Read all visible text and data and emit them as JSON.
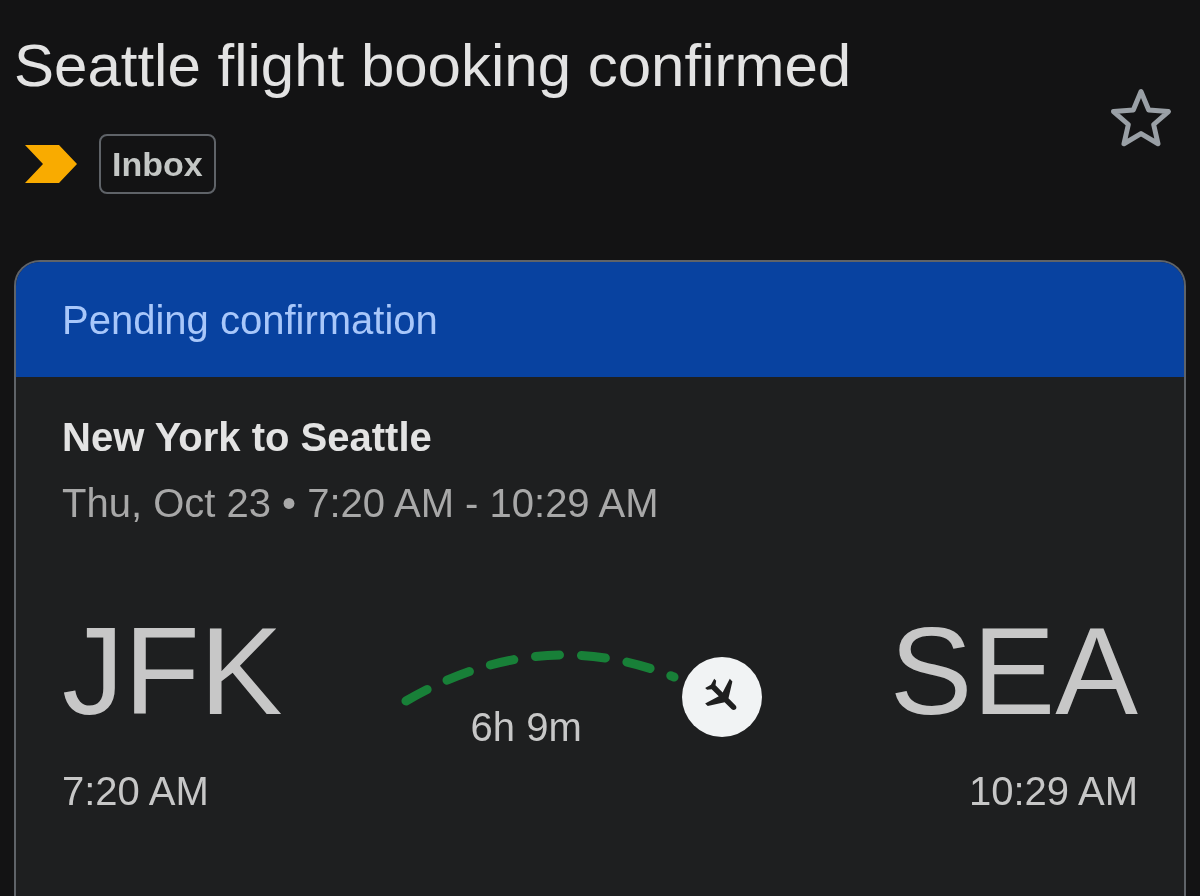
{
  "subject": "Seattle flight booking confirmed",
  "starred": false,
  "important": true,
  "labels": [
    {
      "text": "Inbox"
    }
  ],
  "card": {
    "status": "Pending confirmation",
    "route": "New York to Seattle",
    "schedule": "Thu, Oct 23 • 7:20 AM - 10:29 AM",
    "origin": {
      "code": "JFK",
      "time": "7:20 AM"
    },
    "destination": {
      "code": "SEA",
      "time": "10:29 AM"
    },
    "duration": "6h 9m"
  }
}
